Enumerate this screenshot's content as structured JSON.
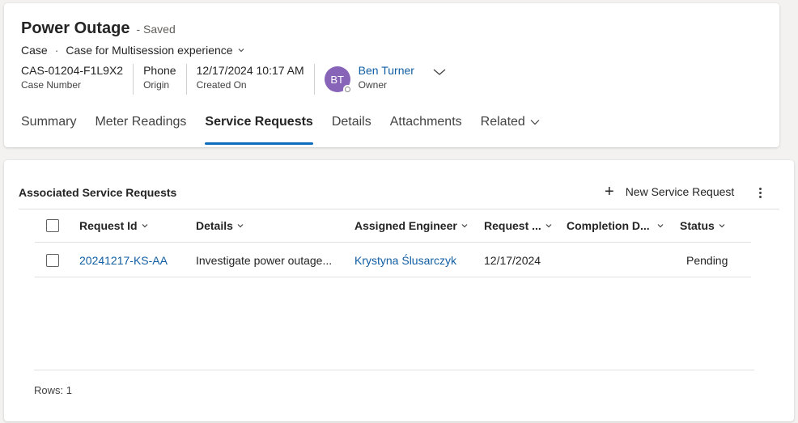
{
  "record": {
    "title": "Power Outage",
    "saved_status": "- Saved",
    "entity": "Case",
    "form_name": "Case for Multisession experience"
  },
  "fields": [
    {
      "value": "CAS-01204-F1L9X2",
      "label": "Case Number"
    },
    {
      "value": "Phone",
      "label": "Origin"
    },
    {
      "value": "12/17/2024 10:17 AM",
      "label": "Created On"
    }
  ],
  "owner": {
    "initials": "BT",
    "name": "Ben Turner",
    "label": "Owner",
    "avatar_color": "#8764b8"
  },
  "tabs": [
    {
      "label": "Summary",
      "active": false
    },
    {
      "label": "Meter Readings",
      "active": false
    },
    {
      "label": "Service Requests",
      "active": true
    },
    {
      "label": "Details",
      "active": false
    },
    {
      "label": "Attachments",
      "active": false
    },
    {
      "label": "Related",
      "active": false,
      "has_chevron": true
    }
  ],
  "grid": {
    "title": "Associated Service Requests",
    "new_button_label": "New Service Request",
    "columns": [
      "Request Id",
      "Details",
      "Assigned Engineer",
      "Request ...",
      "Completion D...",
      "Status"
    ],
    "rows": [
      {
        "request_id": "20241217-KS-AA",
        "details": "Investigate power outage...",
        "engineer": "Krystyna Ślusarczyk",
        "request_date": "12/17/2024",
        "completion_date": "",
        "status": "Pending"
      }
    ],
    "rows_label": "Rows: 1"
  },
  "colors": {
    "accent": "#0f6cbd",
    "link": "#115ea3"
  }
}
